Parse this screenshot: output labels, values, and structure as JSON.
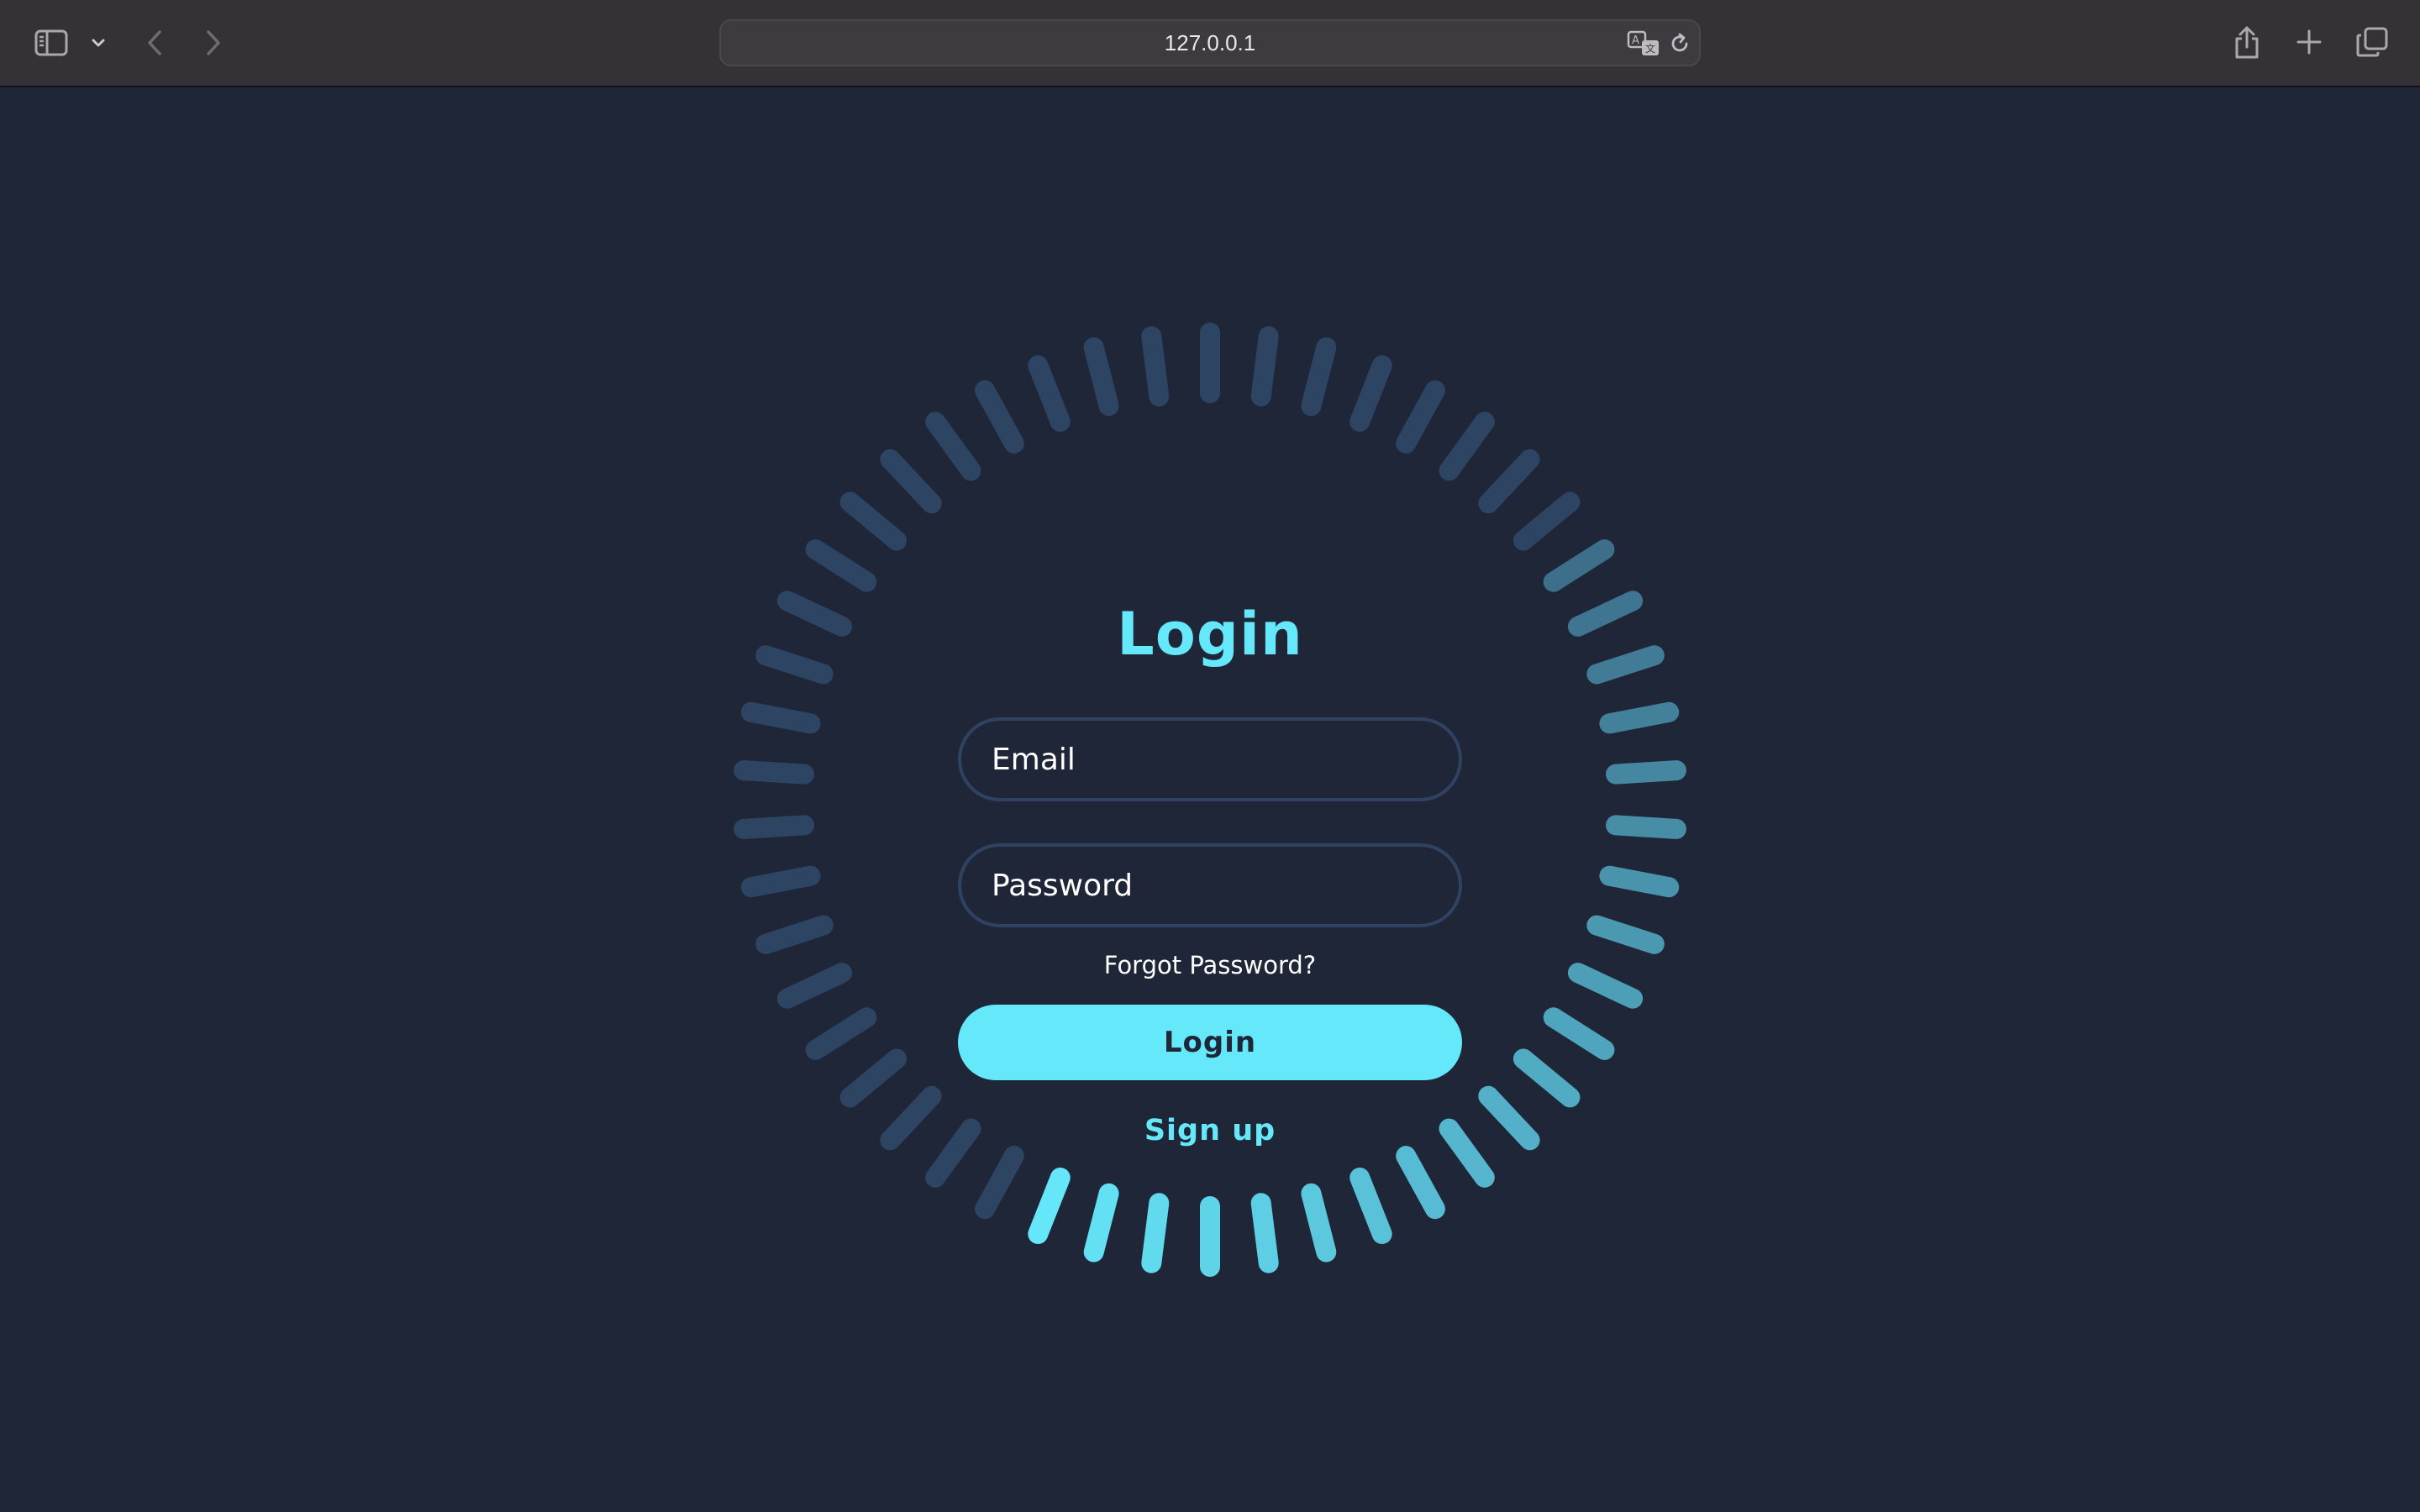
{
  "browser": {
    "url": "127.0.0.1",
    "icons": {
      "sidebar": "sidebar-icon",
      "sidebar_menu": "chevron-down-icon",
      "back": "chevron-left-icon",
      "forward": "chevron-right-icon",
      "translate": "translate-icon",
      "reload": "reload-icon",
      "share": "share-icon",
      "new_tab": "plus-icon",
      "tab_overview": "tabs-icon"
    }
  },
  "login": {
    "title": "Login",
    "email_placeholder": "Email",
    "password_placeholder": "Password",
    "forgot_label": "Forgot Password?",
    "login_button": "Login",
    "signup_label": "Sign up"
  },
  "colors": {
    "page_background": "#1f2637",
    "accent": "#66e8fb",
    "ring_inactive": "#2e4463",
    "field_border": "#2f4262",
    "toolbar": "#343236"
  }
}
